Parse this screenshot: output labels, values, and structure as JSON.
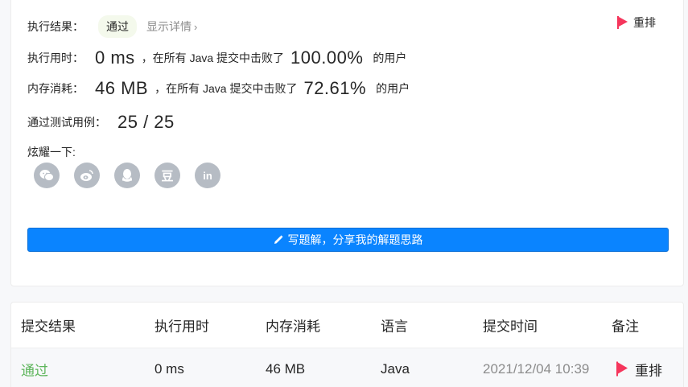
{
  "result": {
    "label": "执行结果：",
    "status": "通过",
    "details": "显示详情",
    "rerun": "重排"
  },
  "runtime": {
    "label": "执行用时：",
    "value": "0 ms",
    "mid": "，在所有 Java 提交中击败了",
    "percent": "100.00%",
    "suffix": "的用户"
  },
  "memory": {
    "label": "内存消耗：",
    "value": "46 MB",
    "mid": "，在所有 Java 提交中击败了",
    "percent": "72.61%",
    "suffix": "的用户"
  },
  "tests": {
    "label": "通过测试用例：",
    "value": "25 / 25"
  },
  "share": {
    "label": "炫耀一下:",
    "icons": [
      "wechat-icon",
      "weibo-icon",
      "qq-icon",
      "douban-icon",
      "linkedin-icon"
    ],
    "douban_glyph": "豆",
    "linkedin_glyph": "in"
  },
  "write_button": "写题解，分享我的解题思路",
  "table": {
    "headers": [
      "提交结果",
      "执行用时",
      "内存消耗",
      "语言",
      "提交时间",
      "备注"
    ],
    "row": {
      "status": "通过",
      "runtime": "0 ms",
      "memory": "46 MB",
      "language": "Java",
      "time": "2021/12/04 10:39",
      "rerun": "重排"
    }
  },
  "colors": {
    "accent": "#0a84ff",
    "pass": "#5db55b",
    "flag": "#f5365c",
    "share_icon_bg": "#b6bcc4"
  }
}
